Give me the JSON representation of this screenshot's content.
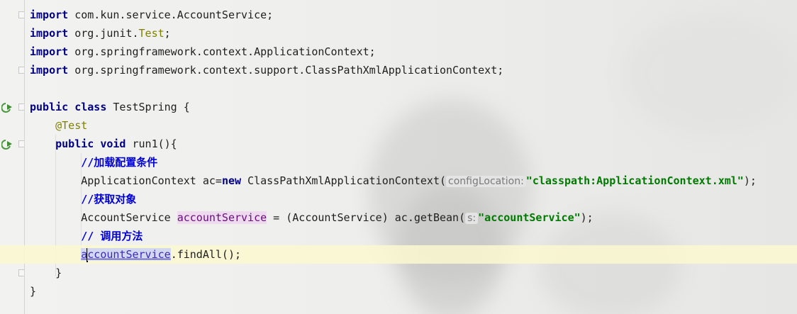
{
  "lines": [
    [
      {
        "t": "import",
        "c": "kw"
      },
      {
        "t": " com.kun.service.AccountService;",
        "c": "txt"
      }
    ],
    [
      {
        "t": "import",
        "c": "kw"
      },
      {
        "t": " org.junit.",
        "c": "txt"
      },
      {
        "t": "Test",
        "c": "ann"
      },
      {
        "t": ";",
        "c": "txt"
      }
    ],
    [
      {
        "t": "import",
        "c": "kw"
      },
      {
        "t": " org.springframework.context.ApplicationContext;",
        "c": "txt"
      }
    ],
    [
      {
        "t": "import",
        "c": "kw"
      },
      {
        "t": " org.springframework.context.support.ClassPathXmlApplicationContext;",
        "c": "txt"
      }
    ],
    [],
    [
      {
        "t": "public",
        "c": "kw"
      },
      {
        "t": " ",
        "c": "txt"
      },
      {
        "t": "class",
        "c": "kw"
      },
      {
        "t": " TestSpring {",
        "c": "txt"
      }
    ],
    [
      {
        "t": "    ",
        "c": "txt"
      },
      {
        "t": "@Test",
        "c": "ann"
      }
    ],
    [
      {
        "t": "    ",
        "c": "txt"
      },
      {
        "t": "public",
        "c": "kw"
      },
      {
        "t": " ",
        "c": "txt"
      },
      {
        "t": "void",
        "c": "kw"
      },
      {
        "t": " run1(){",
        "c": "txt"
      }
    ],
    [
      {
        "t": "        ",
        "c": "txt"
      },
      {
        "t": "//加载配置条件",
        "c": "cmt"
      }
    ],
    [
      {
        "t": "        ApplicationContext ac=",
        "c": "txt"
      },
      {
        "t": "new",
        "c": "kw"
      },
      {
        "t": " ClassPathXmlApplicationContext(",
        "c": "txt"
      },
      {
        "t": "configLocation:",
        "c": "hint"
      },
      {
        "t": "\"classpath:ApplicationContext.xml\"",
        "c": "str"
      },
      {
        "t": ");",
        "c": "txt"
      }
    ],
    [
      {
        "t": "        ",
        "c": "txt"
      },
      {
        "t": "//获取对象",
        "c": "cmt"
      }
    ],
    [
      {
        "t": "        AccountService ",
        "c": "txt"
      },
      {
        "t": "accountService",
        "c": "var"
      },
      {
        "t": " = (AccountService) ac.getBean(",
        "c": "txt"
      },
      {
        "t": "s:",
        "c": "hint"
      },
      {
        "t": "\"accountService\"",
        "c": "str"
      },
      {
        "t": ");",
        "c": "txt"
      }
    ],
    [
      {
        "t": "        ",
        "c": "txt"
      },
      {
        "t": "// 调用方法",
        "c": "cmt"
      }
    ],
    [
      {
        "t": "        ",
        "c": "txt"
      },
      {
        "t": "a",
        "c": "var-link"
      },
      {
        "t": "",
        "c": "caret"
      },
      {
        "t": "ccountService",
        "c": "var-link"
      },
      {
        "t": ".findAll();",
        "c": "txt"
      }
    ],
    [
      {
        "t": "    }",
        "c": "txt"
      }
    ],
    [
      {
        "t": "}",
        "c": "txt"
      }
    ]
  ],
  "current_line": 13,
  "gutter": {
    "run_icons": [
      5,
      7
    ],
    "fold_markers": [
      0,
      3,
      5,
      7,
      14
    ]
  },
  "icons": {
    "run": "run-gutter-icon",
    "fold": "fold-marker"
  },
  "colors": {
    "keyword": "#000080",
    "annotation": "#808000",
    "comment": "#0000d6",
    "string": "#007a00",
    "current_line": "#fcf8d0"
  }
}
